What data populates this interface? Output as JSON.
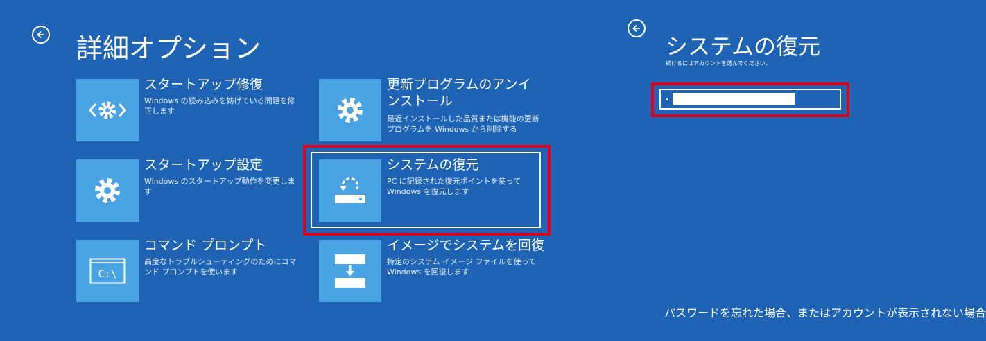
{
  "advanced_options": {
    "title": "詳細オプション",
    "options": [
      {
        "title": "スタートアップ修復",
        "description": "Windows の読み込みを妨げている問題を修正します",
        "icon": "code-gear-icon"
      },
      {
        "title": "スタートアップ設定",
        "description": "Windows のスタートアップ動作を変更します",
        "icon": "gear-icon"
      },
      {
        "title": "コマンド プロンプト",
        "description": "高度なトラブルシューティングのためにコマンド プロンプトを使います",
        "icon": "command-prompt-icon"
      },
      {
        "title": "更新プログラムのアンインストール",
        "description": "最近インストールした品質または機能の更新プログラムを Windows から削除する",
        "icon": "gear-icon"
      },
      {
        "title": "システムの復元",
        "description": "PC に記録された復元ポイントを使って Windows を復元します",
        "icon": "system-restore-icon"
      },
      {
        "title": "イメージでシステムを回復",
        "description": "特定のシステム イメージ ファイルを使って Windows を回復します",
        "icon": "system-image-icon"
      }
    ]
  },
  "system_restore": {
    "title": "システムの復元",
    "instruction": "続けるにはアカウントを選んでください。",
    "forgot_link": "パスワードを忘れた場合、またはアカウントが表示されない場合"
  },
  "colors": {
    "background": "#1f64b4",
    "tile": "#4aa3e3",
    "highlight": "#e0001a",
    "text": "#ffffff"
  }
}
